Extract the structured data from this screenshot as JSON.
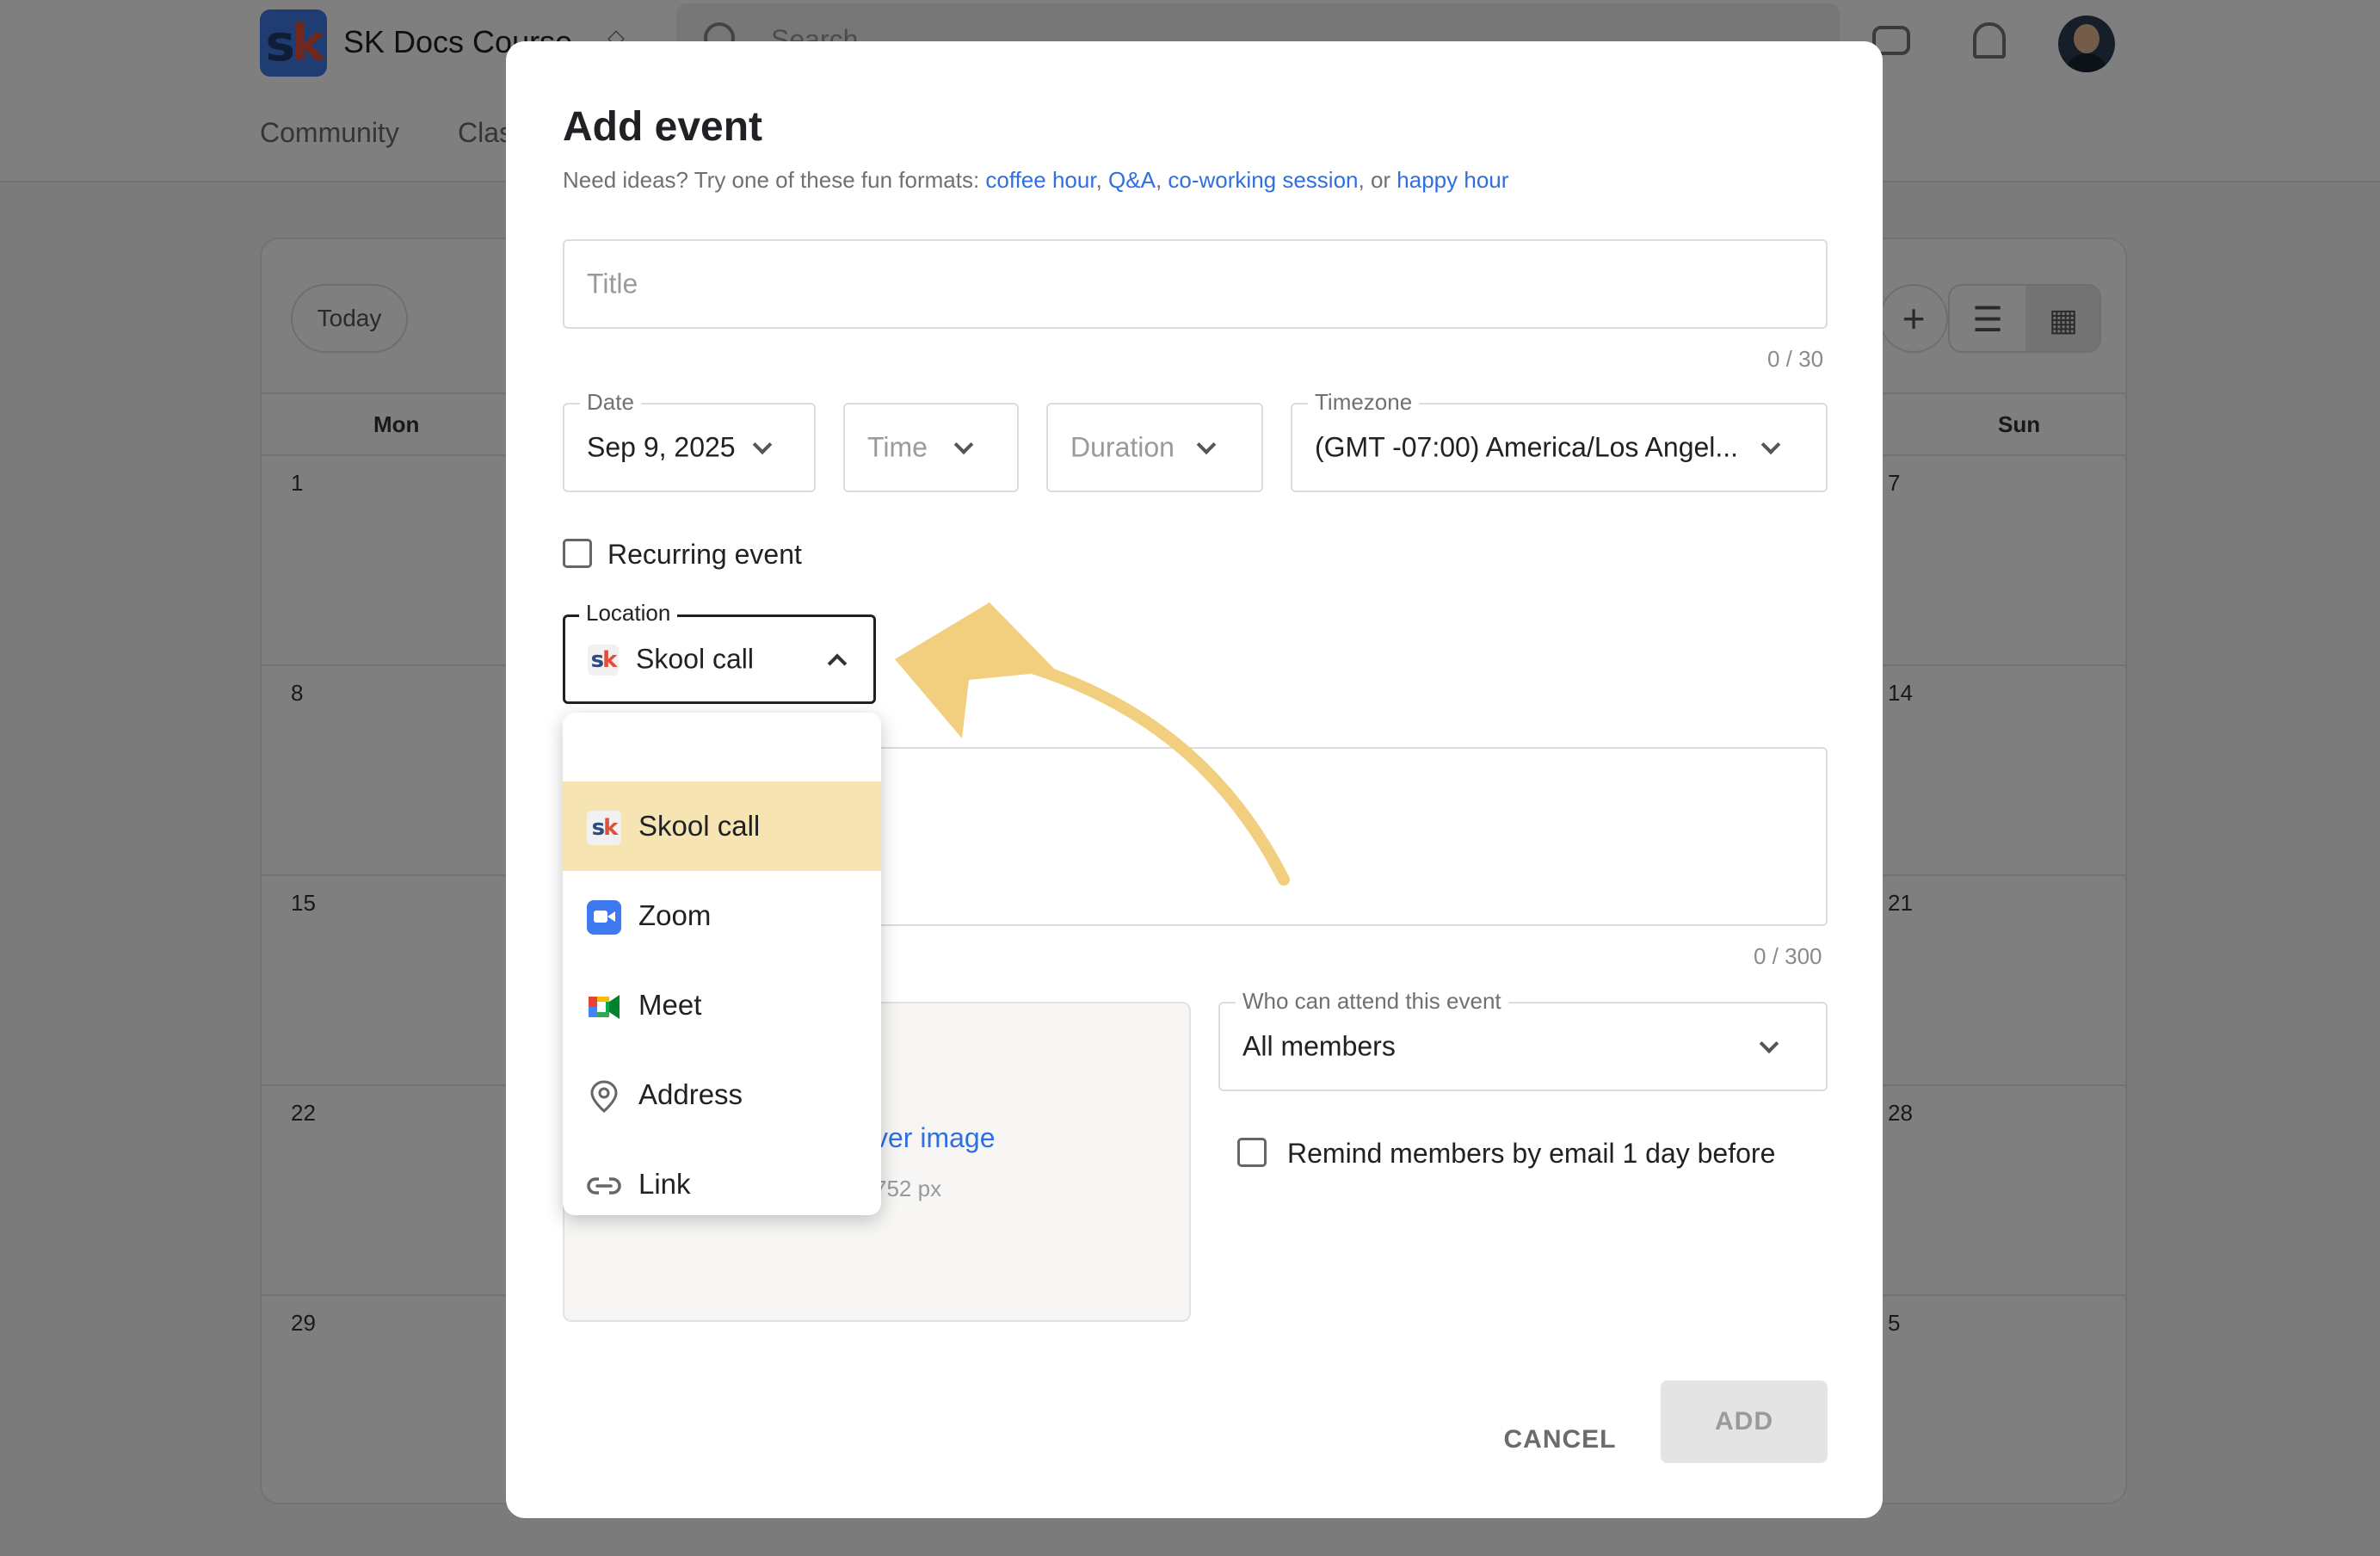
{
  "app": {
    "logo_text_s": "s",
    "logo_text_k": "k",
    "group_name": "SK Docs Course",
    "search_placeholder": "Search",
    "nav_tabs": [
      "Community",
      "Classroom"
    ],
    "icons": [
      "chat-icon",
      "bell-icon",
      "avatar"
    ]
  },
  "calendar": {
    "today_label": "Today",
    "day_headers": [
      "Mon",
      "Sun"
    ],
    "left_column_days": [
      "1",
      "8",
      "15",
      "22",
      "29"
    ],
    "right_column_days": [
      "7",
      "14",
      "21",
      "28",
      "5"
    ]
  },
  "modal": {
    "title": "Add event",
    "subtitle_prefix": "Need ideas? Try one of these fun formats: ",
    "subtitle_links": [
      "coffee hour",
      "Q&A",
      "co-working session",
      "happy hour"
    ],
    "subtitle_sep1": ", ",
    "subtitle_sep2": ", ",
    "subtitle_sep3": ", or ",
    "title_field": {
      "placeholder": "Title",
      "counter": "0 / 30"
    },
    "date_field": {
      "label": "Date",
      "value": "Sep 9, 2025"
    },
    "time_field": {
      "placeholder": "Time"
    },
    "duration_field": {
      "placeholder": "Duration"
    },
    "timezone_field": {
      "label": "Timezone",
      "value": "(GMT -07:00) America/Los Angel..."
    },
    "recurring": {
      "label": "Recurring event",
      "checked": false
    },
    "location_field": {
      "label": "Location",
      "value": "Skool call",
      "options": [
        {
          "label": "Skool call",
          "icon": "skool-icon",
          "selected": true
        },
        {
          "label": "Zoom",
          "icon": "zoom-icon",
          "selected": false
        },
        {
          "label": "Meet",
          "icon": "google-meet-icon",
          "selected": false
        },
        {
          "label": "Address",
          "icon": "map-pin-icon",
          "selected": false
        },
        {
          "label": "Link",
          "icon": "link-icon",
          "selected": false
        }
      ]
    },
    "description_counter": "0 / 300",
    "cover_image": {
      "link_text": "ver image",
      "hint_text": "752 px"
    },
    "attend_field": {
      "label": "Who can attend this event",
      "value": "All members"
    },
    "remind": {
      "label": "Remind members by email 1 day before",
      "checked": false
    },
    "cancel_label": "CANCEL",
    "add_label": "ADD"
  },
  "colors": {
    "accent_link": "#2f6fe0",
    "selected_option_bg": "#f6e4b3",
    "annotation_arrow": "#f2cf7e",
    "overlay": "rgba(0,0,0,0.5)"
  }
}
